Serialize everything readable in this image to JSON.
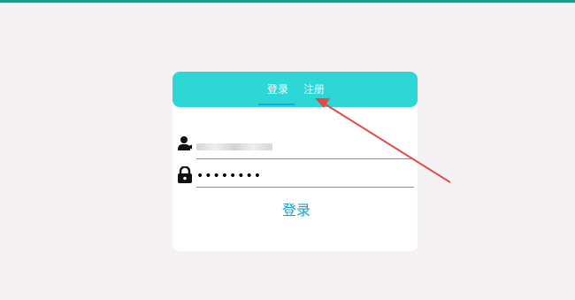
{
  "tabs": {
    "login": "登录",
    "register": "注册"
  },
  "form": {
    "password_mask": "••••••••",
    "submit_label": "登录"
  },
  "colors": {
    "tab_bar": "#2fd6d6",
    "accent": "#19a0c8",
    "annotation_arrow": "#e74848"
  },
  "icons": {
    "user": "user-icon",
    "lock": "lock-icon"
  }
}
